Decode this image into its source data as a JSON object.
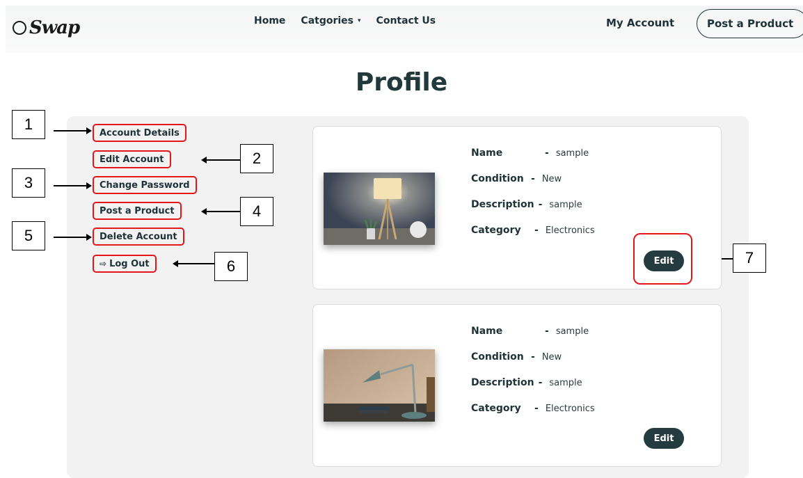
{
  "header": {
    "logo_text": "Swap",
    "nav": [
      {
        "label": "Home"
      },
      {
        "label": "Catgories",
        "caret": "▾"
      },
      {
        "label": "Contact Us"
      }
    ],
    "my_account": "My Account",
    "post_product": "Post a Product"
  },
  "page_title": "Profile",
  "sidebar": {
    "items": [
      {
        "label": "Account Details"
      },
      {
        "label": "Edit Account"
      },
      {
        "label": "Change Password"
      },
      {
        "label": "Post a Product"
      },
      {
        "label": "Delete Account"
      },
      {
        "label": "Log Out",
        "icon": "logout-icon",
        "glyph": "⇨"
      }
    ]
  },
  "callouts": [
    "1",
    "2",
    "3",
    "4",
    "5",
    "6",
    "7"
  ],
  "field_labels": {
    "name": "Name",
    "condition": "Condition",
    "description": "Description",
    "category": "Category",
    "separator": "-"
  },
  "products": [
    {
      "name": "sample",
      "condition": "New",
      "description": "sample",
      "category": "Electronics",
      "edit_label": "Edit",
      "image": "table-lamp-photo"
    },
    {
      "name": "sample",
      "condition": "New",
      "description": "sample",
      "category": "Electronics",
      "edit_label": "Edit",
      "image": "desk-lamp-photo"
    }
  ],
  "colors": {
    "accent_dark": "#243b40",
    "highlight_red": "#e3161b",
    "panel_bg": "#f2f2f2"
  }
}
